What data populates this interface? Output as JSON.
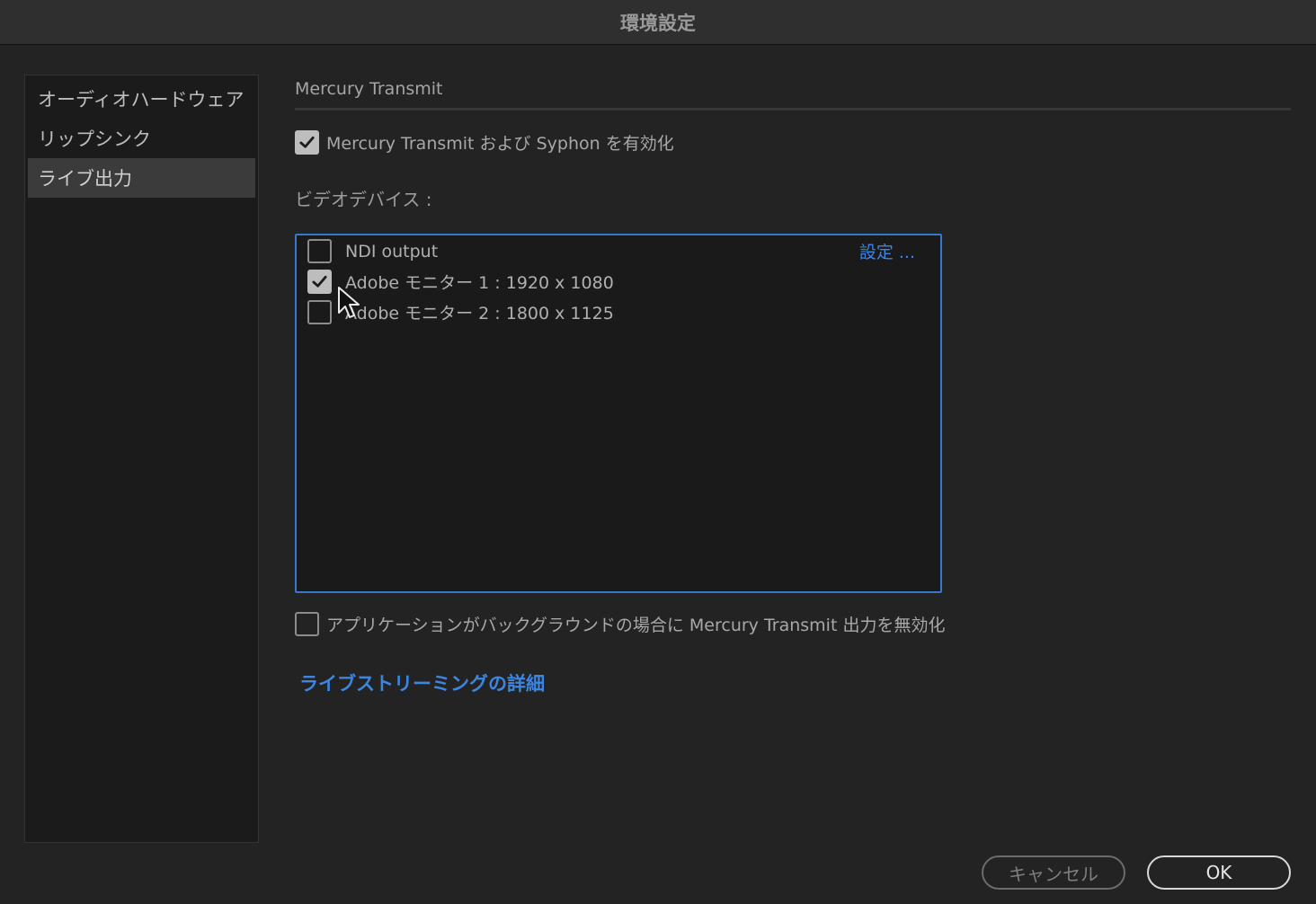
{
  "window": {
    "title": "環境設定"
  },
  "sidebar": {
    "items": [
      {
        "label": "オーディオハードウェア",
        "selected": false
      },
      {
        "label": "リップシンク",
        "selected": false
      },
      {
        "label": "ライブ出力",
        "selected": true
      }
    ]
  },
  "main": {
    "section_title": "Mercury Transmit",
    "enable_checkbox": {
      "label": "Mercury Transmit および Syphon を有効化",
      "checked": true
    },
    "video_devices_label": "ビデオデバイス :",
    "devices": [
      {
        "label": "NDI output",
        "checked": false
      },
      {
        "label": "Adobe モニター 1 : 1920 x 1080",
        "checked": true
      },
      {
        "label": "Adobe モニター 2 : 1800 x 1125",
        "checked": false
      }
    ],
    "device_settings_label": "設定 ...",
    "background_checkbox": {
      "label": "アプリケーションがバックグラウンドの場合に Mercury Transmit 出力を無効化",
      "checked": false
    },
    "learn_more_link": "ライブストリーミングの詳細"
  },
  "footer": {
    "cancel_label": "キャンセル",
    "ok_label": "OK"
  },
  "colors": {
    "accent": "#3579cc",
    "link": "#3d86e0",
    "background": "#232323"
  }
}
